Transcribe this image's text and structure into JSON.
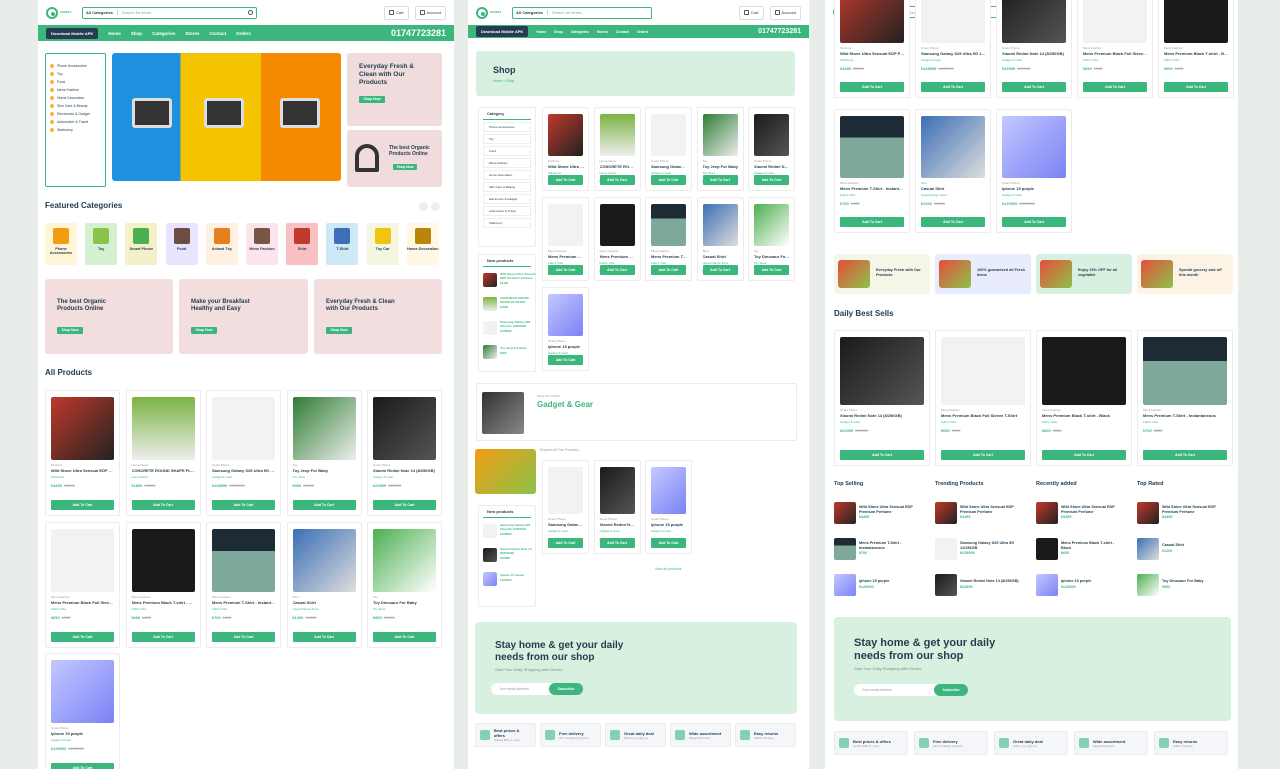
{
  "header": {
    "search_cat": "All Categories",
    "search_placeholder": "Search for items...",
    "cart": "Cart",
    "account": "Account"
  },
  "nav": {
    "app": "Download Mobile APK",
    "items": [
      "Home",
      "Shop",
      "Categories",
      "Stores",
      "Contact",
      "Orders"
    ],
    "phone": "01747723281"
  },
  "home": {
    "sidebar_cats": [
      "Phone Accessories",
      "Toy",
      "Food",
      "Mens Fashion",
      "Home Decoration",
      "Skin Care & Beauty",
      "Electronics & Gadget",
      "Automotive & Travel",
      "Stationery"
    ],
    "banner_right1": "Everyday Fresh & Clean with Our Products",
    "banner_right2": "The best Organic Products Online",
    "shop_now": "Shop Now",
    "featured_title": "Featured Categories",
    "featured": [
      "Phone Accessories",
      "Toy",
      "Smart Phone",
      "Food",
      "Animal Toy",
      "Mens Fashion",
      "Shirt",
      "T-Shirt",
      "Toy Car",
      "Home Decoration"
    ],
    "promo": [
      "The best Organic Products Online",
      "Make your Breakfast Healthy and Easy",
      "Everyday Fresh & Clean with Our Products"
    ],
    "all_products": "All Products"
  },
  "products": [
    {
      "cat": "Perfume",
      "name": "Wild Stone Ultra Sensual EDP Premium Perfume",
      "by": "Wildstone",
      "price": "৳4495",
      "old": "৳5899"
    },
    {
      "cat": "Home Decor",
      "name": "CONCRETE ROUND SHAPE PLANTER",
      "by": "Home Decor",
      "price": "৳1800",
      "old": "৳2000"
    },
    {
      "cat": "Smart Phone",
      "name": "Samsung Galaxy S25 Ultra 5G 12/256GB",
      "by": "Gadget & Gear",
      "price": "৳128999",
      "old": "৳135999"
    },
    {
      "cat": "Toy",
      "name": "Toy Jeep For Baby",
      "by": "Toy Store",
      "price": "৳900",
      "old": "৳1500"
    },
    {
      "cat": "Smart Phone",
      "name": "Xiaomi Redmi Note 14 (8/256GB)",
      "by": "Gadget & Gear",
      "price": "৳22999",
      "old": "৳25999"
    },
    {
      "cat": "Mens Fashion",
      "name": "Mens Premium Black Full Sleeve T-Shirt",
      "by": "Fabric Vibe",
      "price": "৳650",
      "old": "৳950"
    },
    {
      "cat": "Mens Fashion",
      "name": "Mens Premium Black T-shirt - Black",
      "by": "Fabric Vibe",
      "price": "৳600",
      "old": "৳850"
    },
    {
      "cat": "Mens Fashion",
      "name": "Mens Premium T-Shirt - Instantaneous",
      "by": "Fabric Vibe",
      "price": "৳700",
      "old": "৳850"
    },
    {
      "cat": "Shirt",
      "name": "Casual Shirt",
      "by": "Upperchange Store",
      "price": "৳1200",
      "old": "৳1500"
    },
    {
      "cat": "Toy",
      "name": "Toy Dinosaur For Baby",
      "by": "Toy Store",
      "price": "৳900",
      "old": "৳1200"
    },
    {
      "cat": "Smart Phone",
      "name": "iphone 15 purple",
      "by": "Gadget & Gear",
      "price": "৳120000",
      "old": "৳130000"
    }
  ],
  "add_to_cart": "Add To Cart",
  "shop": {
    "title": "Shop",
    "crumb": "Home  >  Shop",
    "category_title": "Category",
    "new_products": "New products",
    "store_name": "Gadget & Gear",
    "store_label": "Shop info GOOD",
    "explore": "Explore All The Products...",
    "view_more": "View all products"
  },
  "page3": {
    "banners": [
      "Everyday Fresh with Our Products",
      "100% guaranteed all Fresh items",
      "Enjoy 15% OFF for all vegetable",
      "Special grocery sale off this month"
    ],
    "daily": "Daily Best Sells",
    "lists": [
      "Top Selling",
      "Trending Products",
      "Recently added",
      "Top Rated"
    ]
  },
  "newsletter": {
    "title": "Stay home & get your daily needs from our shop",
    "sub": "Start Your Daily Shopping with Genixx",
    "placeholder": "Your email address",
    "button": "Subscribe"
  },
  "features": [
    {
      "t": "Best prices & offers",
      "s": "Orders $50 or more"
    },
    {
      "t": "Free delivery",
      "s": "24/7 amazing services"
    },
    {
      "t": "Great daily deal",
      "s": "When you sign up"
    },
    {
      "t": "Wide assortment",
      "s": "Mega Discounts"
    },
    {
      "t": "Easy returns",
      "s": "Within 30 days"
    }
  ],
  "colors": {
    "brand": "#3bb77e",
    "text": "#253d4e"
  }
}
